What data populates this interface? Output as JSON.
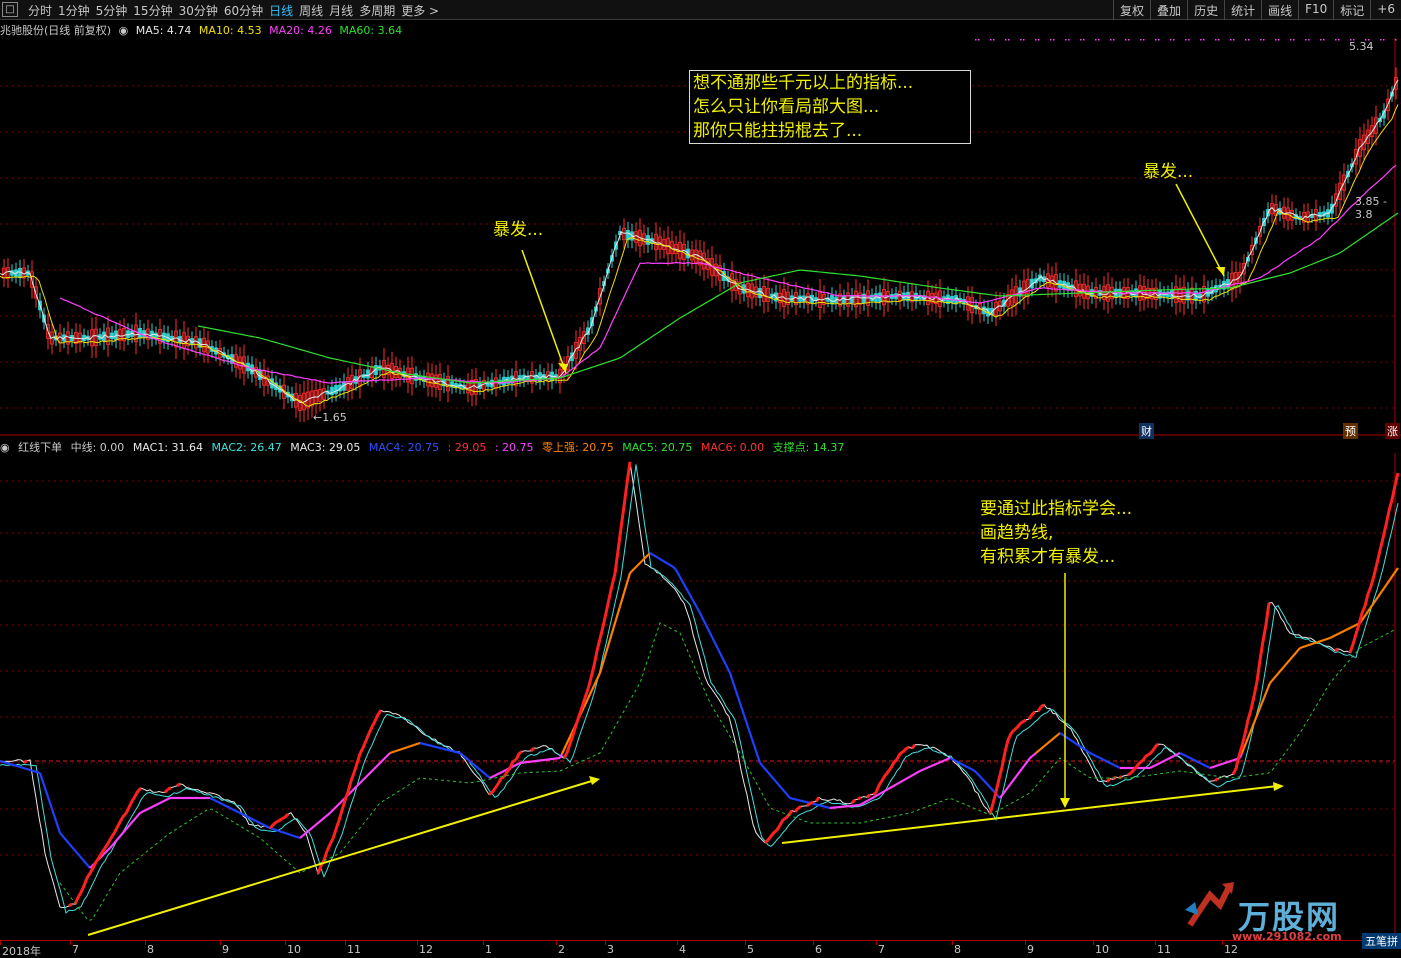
{
  "toolbar": {
    "square_label": "□",
    "periods": [
      "分时",
      "1分钟",
      "5分钟",
      "15分钟",
      "30分钟",
      "60分钟",
      "日线",
      "周线",
      "月线",
      "多周期",
      "更多 >"
    ],
    "active_period": "日线",
    "tools": [
      "复权",
      "叠加",
      "历史",
      "统计",
      "画线",
      "F10",
      "标记",
      "+6"
    ]
  },
  "main": {
    "stock_title": "兆驰股份(日线 前复权)",
    "ma": [
      {
        "label": "MA5: 4.74",
        "color": "#e8e8e8"
      },
      {
        "label": "MA10: 4.53",
        "color": "#f0e000"
      },
      {
        "label": "MA20: 4.26",
        "color": "#ff40ff"
      },
      {
        "label": "MA60: 3.64",
        "color": "#30e030"
      }
    ],
    "high_label": "5.34",
    "low_label": "1.65",
    "mid_label": "3.85 - 3.8",
    "annotation_box": [
      "想不通那些千元以上的指标...",
      "怎么只让你看局部大图...",
      "那你只能拄拐棍去了..."
    ],
    "burst_label_1": "暴发...",
    "burst_label_2": "暴发...",
    "tags": {
      "cai": "财",
      "yu": "预",
      "zhang": "涨"
    }
  },
  "indicator": {
    "name": "红线下单",
    "items": [
      {
        "label": "中线: 0.00",
        "color": "#c8c8c8"
      },
      {
        "label": "MAC1: 31.64",
        "color": "#e8e8e8"
      },
      {
        "label": "MAC2: 26.47",
        "color": "#40e0e0"
      },
      {
        "label": "MAC3: 29.05",
        "color": "#e8e8e8"
      },
      {
        "label": "MAC4: 20.75",
        "color": "#3050ff"
      },
      {
        "label": ": 29.05",
        "color": "#ff3030"
      },
      {
        "label": ": 20.75",
        "color": "#ff40ff"
      },
      {
        "label": "零上强: 20.75",
        "color": "#ff8000"
      },
      {
        "label": "MAC5: 20.75",
        "color": "#30e030"
      },
      {
        "label": "MAC6: 0.00",
        "color": "#ff3030"
      },
      {
        "label": "支撑点: 14.37",
        "color": "#30e030"
      }
    ],
    "annotation": [
      "要通过此指标学会...",
      "画趋势线,",
      "有积累才有暴发..."
    ]
  },
  "date_axis": [
    "2018年",
    "7",
    "8",
    "9",
    "10",
    "11",
    "12",
    "1",
    "2",
    "3",
    "4",
    "5",
    "6",
    "7",
    "8",
    "9",
    "10",
    "11",
    "12"
  ],
  "logo": {
    "brand": "万股网",
    "url": "www.291082.com"
  },
  "bottom_badge": "五笔拼"
}
